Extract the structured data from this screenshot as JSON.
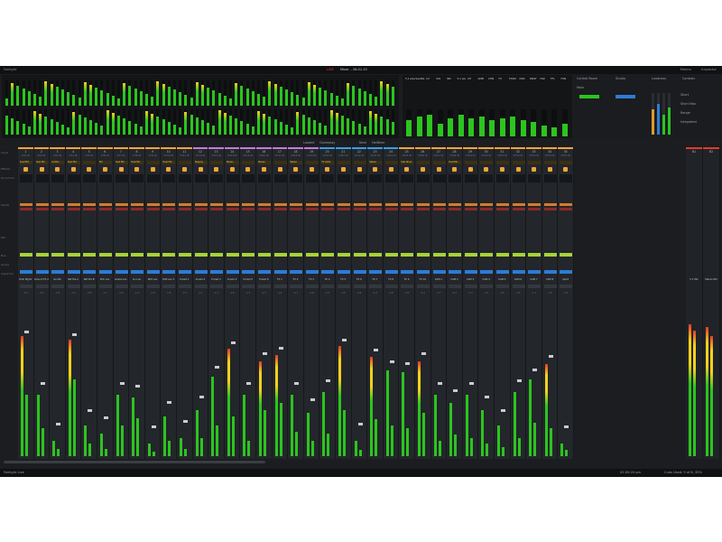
{
  "titlebar": {
    "app_label": "Fairlight",
    "live_badge": "LIVE",
    "project_title": "Mixer – 26.01.15",
    "right_items": [
      "Meters",
      "Inspector"
    ]
  },
  "control_room": {
    "title": "Control Room",
    "studio": "Studio",
    "loudness": "Loudness",
    "controls": "Controls",
    "main": "Main",
    "short": "Short",
    "short_max": "Short Max",
    "range": "Range",
    "integrated": "Integrated"
  },
  "monitor_labels": [
    "5.1 plex",
    "Seattle",
    "Inf",
    "IN1",
    "IN3",
    "5.1 pls",
    "2H",
    "AMB",
    "CHN",
    "FX",
    "FXWV",
    "DNS",
    "DNST",
    "FAR",
    "FFL",
    "FXN"
  ],
  "subheader": {
    "label_a": "Loaded",
    "label_b": "Gameplay",
    "label_c": "Next",
    "label_d": "Halftime"
  },
  "row_labels": [
    "Input",
    "Effects",
    "Dynamics",
    "Sends",
    "Pan",
    "Bus",
    "Group",
    "Inspector"
  ],
  "strips": [
    {
      "num": "1",
      "sub": "CH1 IN",
      "plug": "Dual Mic",
      "tag": "Rink Mgmt",
      "color": "#f2a53a",
      "val": "-1.5",
      "bars": [
        0.78,
        0.4
      ]
    },
    {
      "num": "2",
      "sub": "CH2 IN",
      "plug": "Dual Mic",
      "tag": "Ground FX 2",
      "color": "#f2a53a",
      "val": "-2.2",
      "bars": [
        0.4,
        0.18
      ]
    },
    {
      "num": "3",
      "sub": "CH3 IN",
      "plug": "Limiter",
      "tag": "Ice Mic",
      "color": "#f2a53a",
      "val": "-1.8",
      "bars": [
        0.1,
        0.05
      ]
    },
    {
      "num": "4",
      "sub": "CH4 IN",
      "plug": "Dual Mic",
      "tag": "Ref Pre A",
      "color": "#f2a53a",
      "val": "-1.2",
      "bars": [
        0.76,
        0.5
      ]
    },
    {
      "num": "5",
      "sub": "CH5 IN",
      "plug": "",
      "tag": "Ref Pre B",
      "color": "#f2a53a",
      "val": "-2.8",
      "bars": [
        0.2,
        0.08
      ]
    },
    {
      "num": "6",
      "sub": "CH6 IN",
      "plug": "Mic",
      "tag": "Bch Lav",
      "color": "#f2a53a",
      "val": "-1.7",
      "bars": [
        0.15,
        0.05
      ]
    },
    {
      "num": "7",
      "sub": "CH7 IN",
      "plug": "Dual Mic",
      "tag": "Goalie Lav",
      "color": "#f2a53a",
      "val": "-1.6",
      "bars": [
        0.4,
        0.2
      ]
    },
    {
      "num": "8",
      "sub": "CH8 IN",
      "plug": "Dual Mic",
      "tag": "Lin Lav",
      "color": "#f2a53a",
      "val": "-1.4",
      "bars": [
        0.38,
        0.25
      ]
    },
    {
      "num": "9",
      "sub": "CH9 IN",
      "plug": "",
      "tag": "Wht Lav",
      "color": "#f2a53a",
      "val": "-2.0",
      "bars": [
        0.08,
        0.03
      ]
    },
    {
      "num": "10",
      "sub": "CH10 IN",
      "plug": "Dual Mic",
      "tag": "Wht Lav 2",
      "color": "#f2a53a",
      "val": "-1.9",
      "bars": [
        0.26,
        0.1
      ]
    },
    {
      "num": "11",
      "sub": "CH11 IN",
      "plug": "",
      "tag": "Crowd 1",
      "color": "#f2a53a",
      "val": "-1.5",
      "bars": [
        0.12,
        0.05
      ]
    },
    {
      "num": "12",
      "sub": "CH12 IN",
      "plug": "Staging",
      "tag": "Crowd 2",
      "color": "#c27bd6",
      "val": "-1.1",
      "bars": [
        0.3,
        0.12
      ]
    },
    {
      "num": "13",
      "sub": "CH13 IN",
      "plug": "",
      "tag": "Crowd 3",
      "color": "#c27bd6",
      "val": "-1.2",
      "bars": [
        0.52,
        0.2
      ]
    },
    {
      "num": "14",
      "sub": "CH14 IN",
      "plug": "Stereo",
      "tag": "Crowd 4",
      "color": "#c27bd6",
      "val": "-1.6",
      "bars": [
        0.7,
        0.26
      ]
    },
    {
      "num": "15",
      "sub": "CH15 IN",
      "plug": "",
      "tag": "Crowd 5",
      "color": "#c27bd6",
      "val": "-1.3",
      "bars": [
        0.4,
        0.1
      ]
    },
    {
      "num": "16",
      "sub": "CH16 IN",
      "plug": "Stereo",
      "tag": "Crowd 6",
      "color": "#c27bd6",
      "val": "-1.3",
      "bars": [
        0.62,
        0.3
      ]
    },
    {
      "num": "17",
      "sub": "CH17 IN",
      "plug": "",
      "tag": "FX 1",
      "color": "#c27bd6",
      "val": "-1.4",
      "bars": [
        0.66,
        0.35
      ]
    },
    {
      "num": "18",
      "sub": "CH18 IN",
      "plug": "Stereo",
      "tag": "FX 2",
      "color": "#c27bd6",
      "val": "-2.1",
      "bars": [
        0.4,
        0.16
      ]
    },
    {
      "num": "19",
      "sub": "CH19 IN",
      "plug": "",
      "tag": "FX 3",
      "color": "#c27bd6",
      "val": "-1.8",
      "bars": [
        0.28,
        0.1
      ]
    },
    {
      "num": "20",
      "sub": "CH20 IN",
      "plug": "FX Ambi",
      "tag": "FX 4",
      "color": "#3a9de8",
      "val": "-2.3",
      "bars": [
        0.42,
        0.15
      ]
    },
    {
      "num": "21",
      "sub": "CH21 IN",
      "plug": "",
      "tag": "FX 5",
      "color": "#3a9de8",
      "val": "-1.5",
      "bars": [
        0.72,
        0.3
      ]
    },
    {
      "num": "22",
      "sub": "CH22 IN",
      "plug": "",
      "tag": "FX 6",
      "color": "#3a9de8",
      "val": "-2.4",
      "bars": [
        0.1,
        0.04
      ]
    },
    {
      "num": "23",
      "sub": "CH23 IN",
      "plug": "Stereo",
      "tag": "FX 7",
      "color": "#3a9de8",
      "val": "-1.2",
      "bars": [
        0.65,
        0.24
      ]
    },
    {
      "num": "24",
      "sub": "CH24 IN",
      "plug": "",
      "tag": "FX 8",
      "color": "#3a9de8",
      "val": "-1.6",
      "bars": [
        0.56,
        0.2
      ]
    },
    {
      "num": "25",
      "sub": "CH25 IN",
      "plug": "Sub Drive",
      "tag": "FX 9",
      "color": "#f2a53a",
      "val": "-2.0",
      "bars": [
        0.55,
        0.18
      ]
    },
    {
      "num": "26",
      "sub": "CH26 IN",
      "plug": "",
      "tag": "FX 10",
      "color": "#f2a53a",
      "val": "-1.4",
      "bars": [
        0.62,
        0.28
      ]
    },
    {
      "num": "27",
      "sub": "CH27 IN",
      "plug": "",
      "tag": "CAM 1",
      "color": "#f2a53a",
      "val": "-1.7",
      "bars": [
        0.4,
        0.1
      ]
    },
    {
      "num": "28",
      "sub": "CH28 IN",
      "plug": "Dual Mic",
      "tag": "CAM 2",
      "color": "#f2a53a",
      "val": "-2.2",
      "bars": [
        0.35,
        0.14
      ]
    },
    {
      "num": "29",
      "sub": "CH29 IN",
      "plug": "",
      "tag": "CAM 3",
      "color": "#f2a53a",
      "val": "-1.3",
      "bars": [
        0.4,
        0.12
      ]
    },
    {
      "num": "30",
      "sub": "CH30 IN",
      "plug": "",
      "tag": "CAM 4",
      "color": "#f2a53a",
      "val": "-1.5",
      "bars": [
        0.3,
        0.08
      ]
    },
    {
      "num": "31",
      "sub": "CH31 IN",
      "plug": "",
      "tag": "CAM 5",
      "color": "#f2a53a",
      "val": "-2.6",
      "bars": [
        0.2,
        0.06
      ]
    },
    {
      "num": "32",
      "sub": "CH32 IN",
      "plug": "",
      "tag": "CAM 6",
      "color": "#f2a53a",
      "val": "-1.9",
      "bars": [
        0.42,
        0.12
      ]
    },
    {
      "num": "33",
      "sub": "CH33 IN",
      "plug": "",
      "tag": "CAM 7",
      "color": "#f2a53a",
      "val": "-1.1",
      "bars": [
        0.5,
        0.22
      ]
    },
    {
      "num": "34",
      "sub": "CH34 IN",
      "plug": "",
      "tag": "CAM 8",
      "color": "#f2a53a",
      "val": "-1.8",
      "bars": [
        0.6,
        0.18
      ]
    },
    {
      "num": "35",
      "sub": "CH35 IN",
      "plug": "",
      "tag": "Sport",
      "color": "#f2a53a",
      "val": "-2.0",
      "bars": [
        0.08,
        0.04
      ]
    }
  ],
  "buses": [
    {
      "num": "B1",
      "tag": "5.1 Mix",
      "bars": [
        0.86,
        0.82
      ]
    },
    {
      "num": "B2",
      "tag": "Stereo Mix",
      "bars": [
        0.84,
        0.78
      ]
    }
  ],
  "statusbar": {
    "app": "Fairlight Live",
    "time": "02:00:20 pm",
    "current_count": "Cues Used: 9 of 8, 35%"
  }
}
